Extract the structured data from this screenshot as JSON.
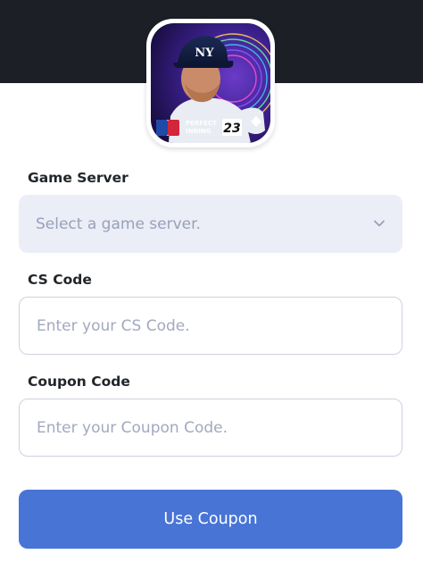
{
  "app_icon": {
    "brand_text_line1": "PERFECT",
    "brand_text_line2": "INNING",
    "year_badge": "23"
  },
  "form": {
    "game_server": {
      "label": "Game Server",
      "placeholder": "Select a game server."
    },
    "cs_code": {
      "label": "CS Code",
      "placeholder": "Enter your CS Code."
    },
    "coupon_code": {
      "label": "Coupon Code",
      "placeholder": "Enter your Coupon Code."
    },
    "submit_label": "Use Coupon"
  },
  "colors": {
    "header_bg": "#1c1f26",
    "select_bg": "#ebedf7",
    "button_bg": "#4874d6",
    "label_text": "#222629",
    "placeholder_text": "#9aa0b8"
  },
  "icons": {
    "select_chevron": "chevron-down-icon",
    "app_logo": "perfect-inning-23-logo"
  }
}
